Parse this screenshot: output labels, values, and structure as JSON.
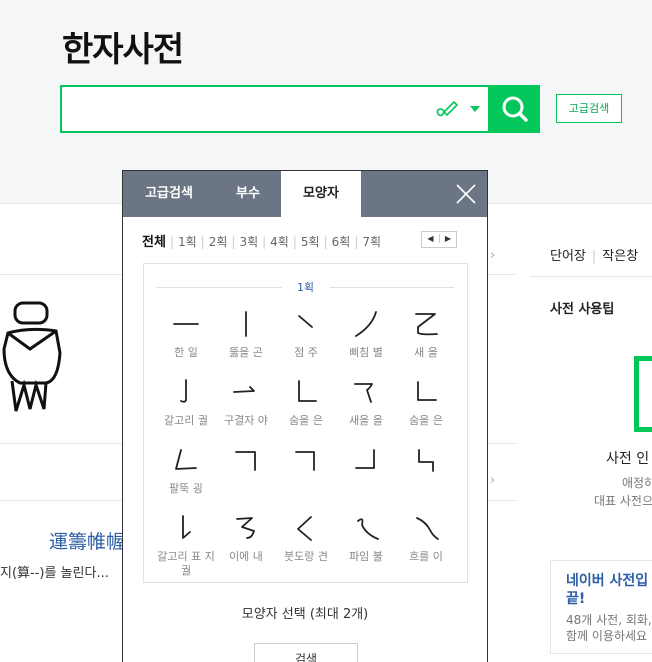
{
  "header": {
    "logo": "한자사전",
    "search": {
      "value": "",
      "placeholder": ""
    },
    "advanced_button": "고급검색"
  },
  "left": {
    "word": "運籌帷幄",
    "meaning": "지(算--)를 놀린다..."
  },
  "right": {
    "tabs": [
      "단어장",
      "작은창"
    ],
    "tip_title": "사전 사용팁",
    "tip_heading": "사전 인",
    "tip_line1": "애정하",
    "tip_line2": "대표 사전으",
    "naver_title_1": "네이버 사전입",
    "naver_title_2": "끝!",
    "naver_desc_1": "48개 사전, 회화,",
    "naver_desc_2": "함께 이용하세요"
  },
  "popup": {
    "tabs": [
      "고급검색",
      "부수",
      "모양자"
    ],
    "active_tab": 2,
    "stroke_filters": [
      "전체",
      "1획",
      "2획",
      "3획",
      "4획",
      "5획",
      "6획",
      "7획"
    ],
    "stroke_group_title": "1획",
    "shapes": [
      {
        "glyph": "hline",
        "label": "한 일"
      },
      {
        "glyph": "vline",
        "label": "뚫을 곤"
      },
      {
        "glyph": "dot",
        "label": "점 주"
      },
      {
        "glyph": "pie",
        "label": "삐침 별"
      },
      {
        "glyph": "yi",
        "label": "새 을"
      },
      {
        "glyph": "hook",
        "label": "갈고리 궐"
      },
      {
        "glyph": "hookright",
        "label": "구결자 야"
      },
      {
        "glyph": "hidden",
        "label": "숨을 은"
      },
      {
        "glyph": "newyi",
        "label": "새을 을"
      },
      {
        "glyph": "hidden2",
        "label": "숨을 은"
      },
      {
        "glyph": "paltok",
        "label": "팔뚝 굉"
      },
      {
        "glyph": "s12",
        "label": ""
      },
      {
        "glyph": "s13",
        "label": ""
      },
      {
        "glyph": "s14",
        "label": ""
      },
      {
        "glyph": "s15",
        "label": ""
      },
      {
        "glyph": "hookmark",
        "label": "갈고리 표 지 궐"
      },
      {
        "glyph": "s17",
        "label": "이에 내"
      },
      {
        "glyph": "s18",
        "label": "붓도랑 견"
      },
      {
        "glyph": "s19",
        "label": "파임 불"
      },
      {
        "glyph": "s20",
        "label": "흐를 이"
      }
    ],
    "select_info": "모양자 선택 (최대 2개)",
    "search_button": "검색"
  }
}
